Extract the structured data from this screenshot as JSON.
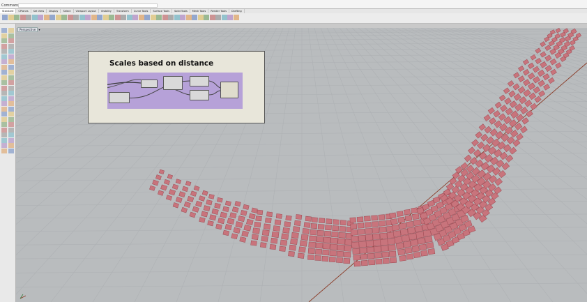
{
  "command_bar": {
    "history_text": "",
    "label": "Command:",
    "value": ""
  },
  "tabs": [
    "Standard",
    "CPlanes",
    "Set View",
    "Display",
    "Select",
    "Viewport Layout",
    "Visibility",
    "Transform",
    "Curve Tools",
    "Surface Tools",
    "Solid Tools",
    "Mesh Tools",
    "Render Tools",
    "Drafting"
  ],
  "viewport": {
    "name": "Perspective"
  },
  "grasshopper": {
    "title": "Scales based on distance"
  },
  "colors": {
    "panel": "#c8747c",
    "panel_edge": "#9e4a53",
    "axis_x": "#8a3a25",
    "gh_canvas": "#b6a1d8"
  }
}
